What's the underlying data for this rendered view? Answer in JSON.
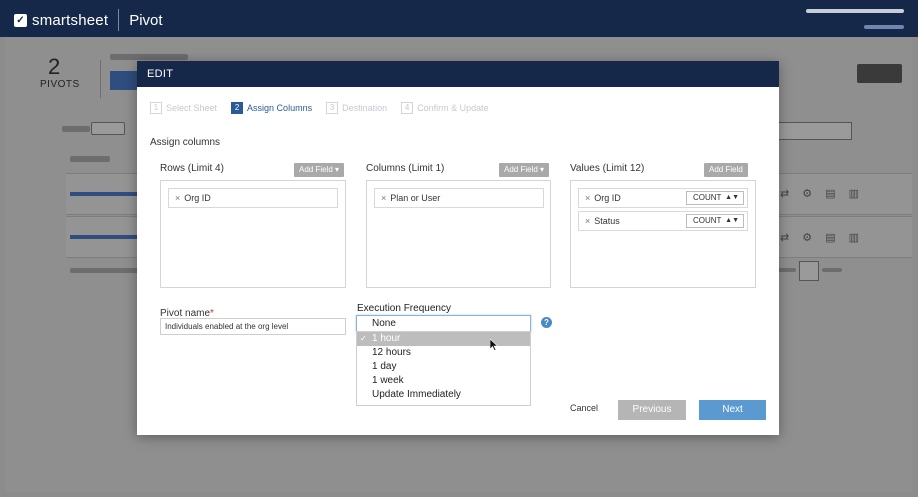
{
  "topbar": {
    "logo_text": "smartsheet",
    "logo_mark": "✓",
    "app_name": "Pivot"
  },
  "background": {
    "pivot_count": "2",
    "pivot_count_label": "PIVOTS"
  },
  "modal": {
    "title": "EDIT",
    "steps": [
      {
        "num": "1",
        "label": "Select Sheet"
      },
      {
        "num": "2",
        "label": "Assign Columns"
      },
      {
        "num": "3",
        "label": "Destination"
      },
      {
        "num": "4",
        "label": "Confirm & Update"
      }
    ],
    "assign_title": "Assign columns",
    "rows": {
      "label": "Rows (Limit 4)",
      "add_field": "Add Field ▾",
      "fields": [
        "Org ID"
      ]
    },
    "columns": {
      "label": "Columns (Limit 1)",
      "add_field": "Add Field ▾",
      "fields": [
        "Plan or User"
      ]
    },
    "values": {
      "label": "Values (Limit 12)",
      "add_field": "Add Field",
      "fields": [
        {
          "name": "Org ID",
          "agg": "COUNT"
        },
        {
          "name": "Status",
          "agg": "COUNT"
        }
      ]
    },
    "pivot_name": {
      "label": "Pivot name",
      "required_mark": "*",
      "value": "Individuals enabled at the org level"
    },
    "execution_frequency": {
      "label": "Execution Frequency",
      "current": "None",
      "options": [
        "1 hour",
        "12 hours",
        "1 day",
        "1 week",
        "Update Immediately"
      ],
      "checked": "✓"
    },
    "cancel_label": "Cancel",
    "previous_label": "Previous",
    "next_label": "Next"
  }
}
